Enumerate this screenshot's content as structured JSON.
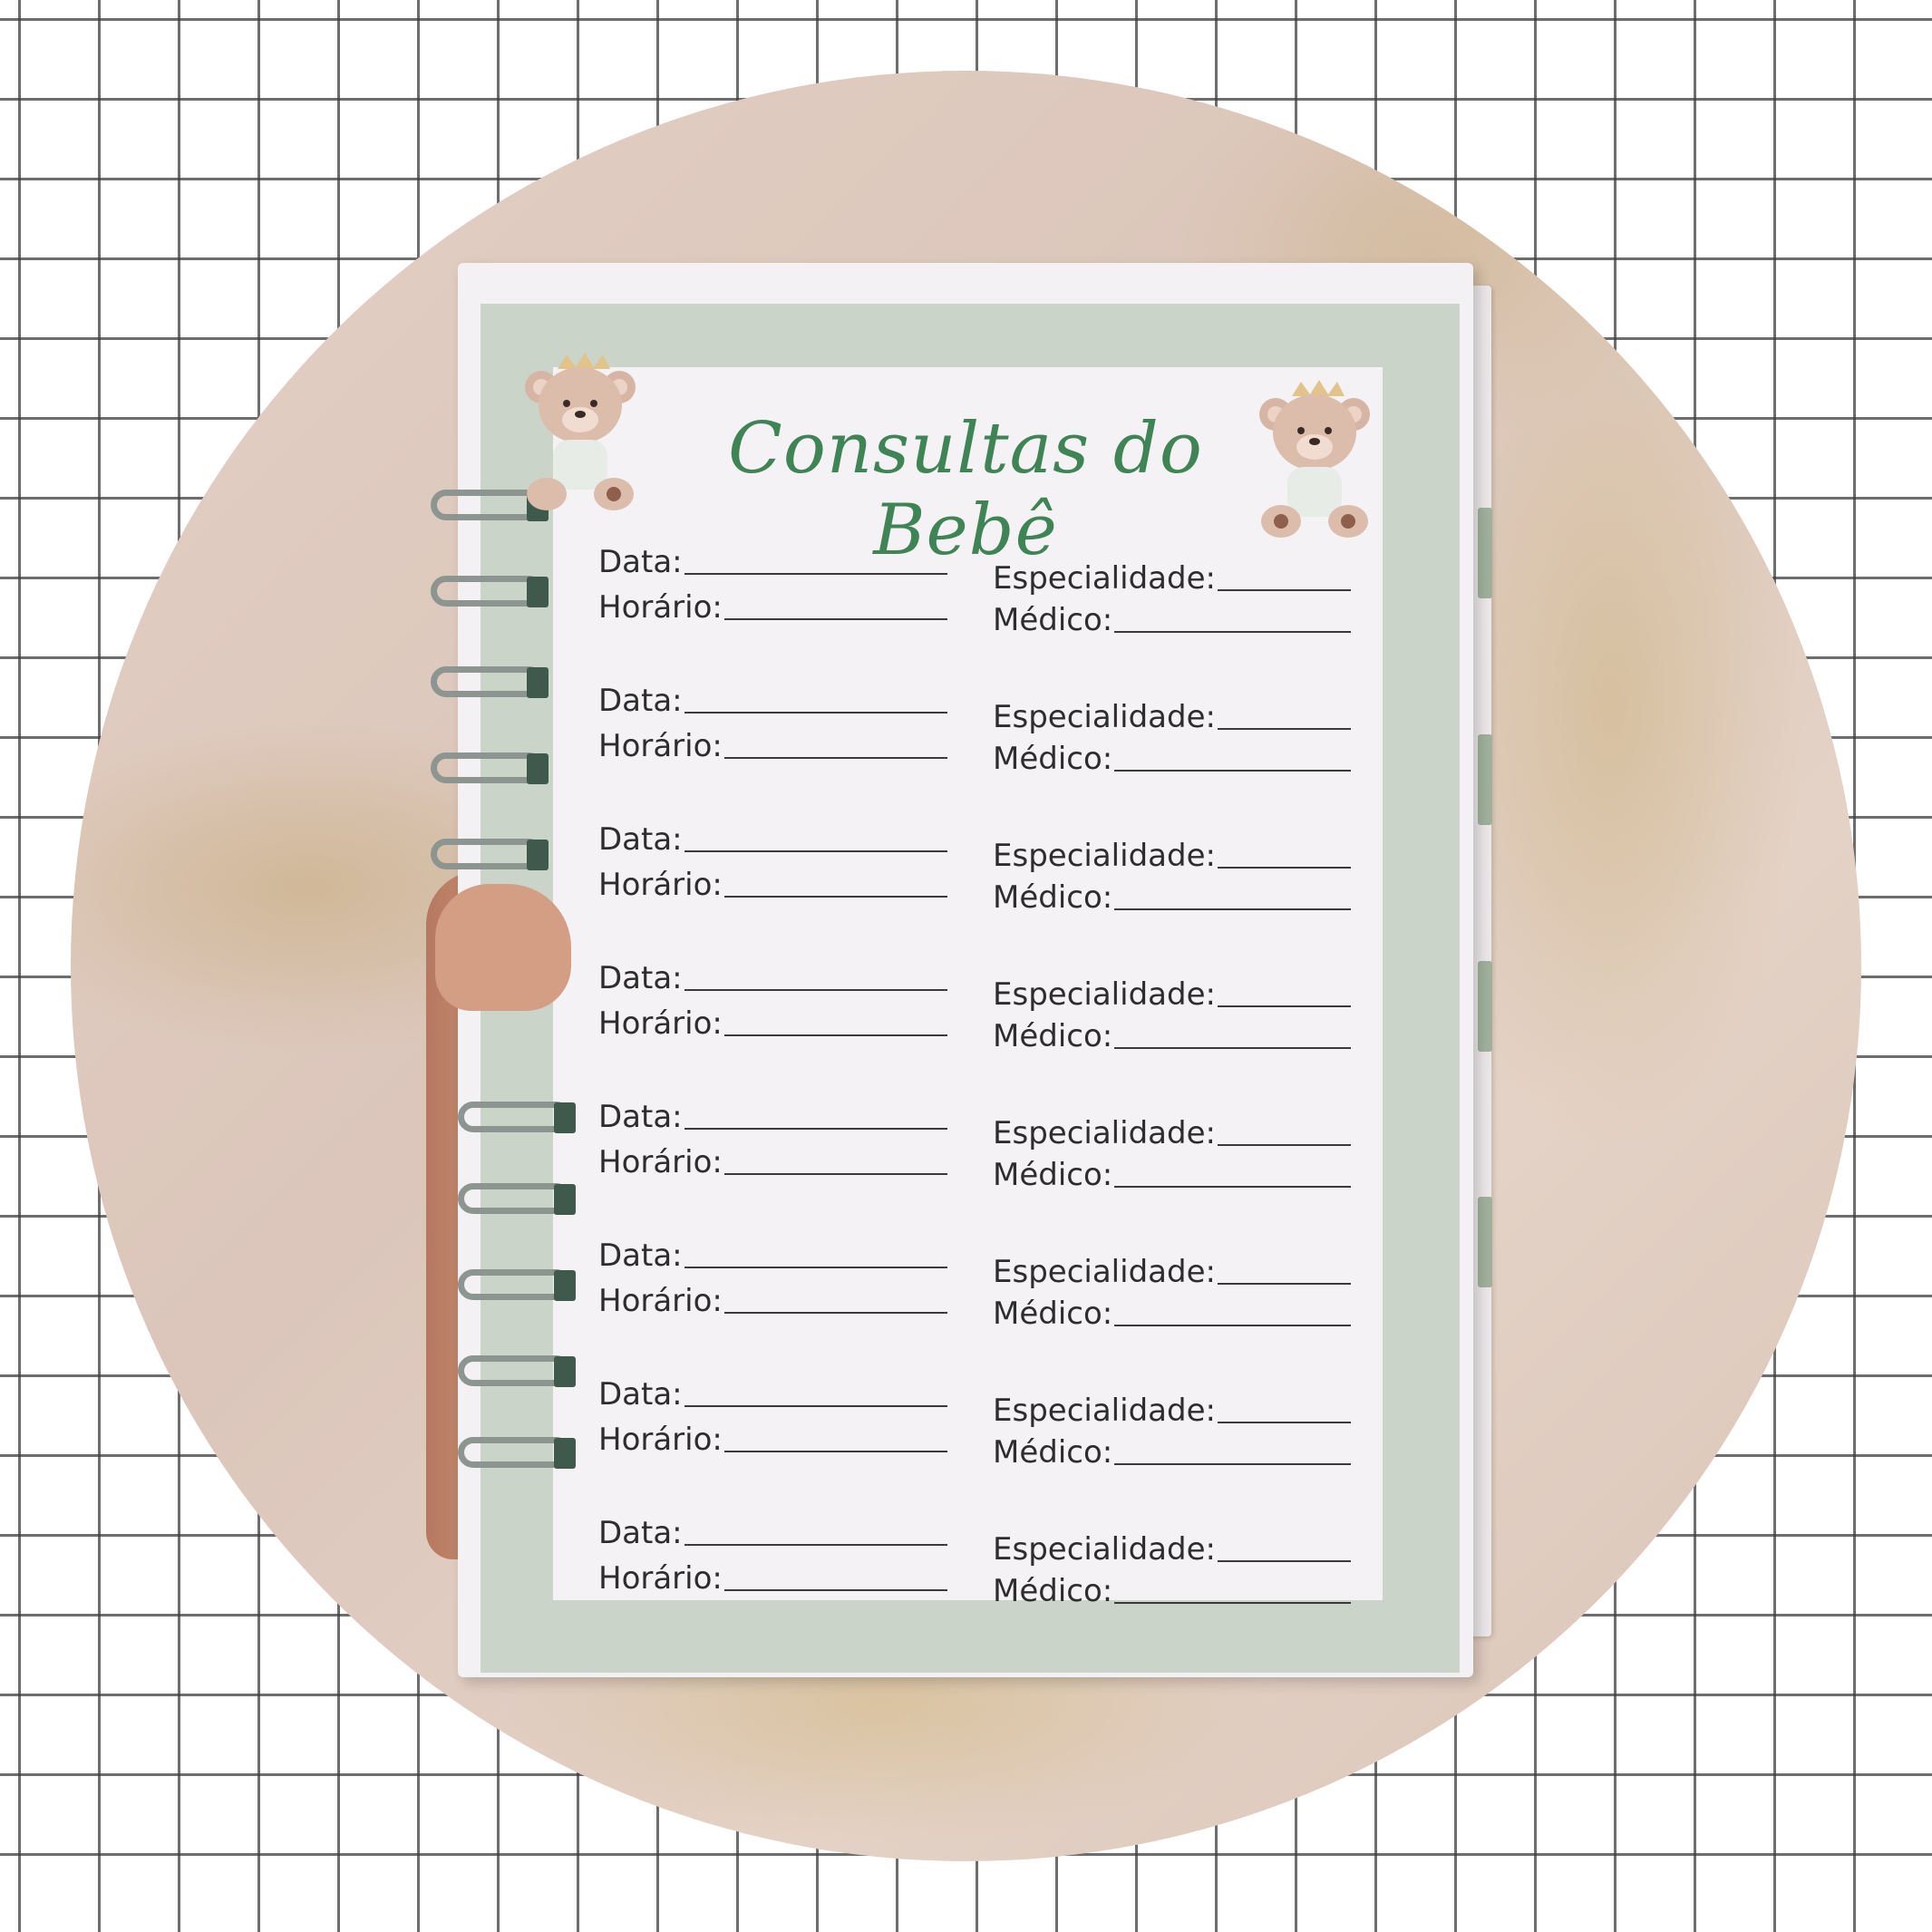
{
  "title": "Consultas do Bebê",
  "entries": [
    {
      "data": "Data:",
      "horario": "Horário:",
      "especialidade": "Especialidade:",
      "medico": "Médico:"
    },
    {
      "data": "Data:",
      "horario": "Horário:",
      "especialidade": "Especialidade:",
      "medico": "Médico:"
    },
    {
      "data": "Data:",
      "horario": "Horário:",
      "especialidade": "Especialidade:",
      "medico": "Médico:"
    },
    {
      "data": "Data:",
      "horario": "Horário:",
      "especialidade": "Especialidade:",
      "medico": "Médico:"
    },
    {
      "data": "Data:",
      "horario": "Horário:",
      "especialidade": "Especialidade:",
      "medico": "Médico:"
    },
    {
      "data": "Data:",
      "horario": "Horário:",
      "especialidade": "Especialidade:",
      "medico": "Médico:"
    },
    {
      "data": "Data:",
      "horario": "Horário:",
      "especialidade": "Especialidade:",
      "medico": "Médico:"
    },
    {
      "data": "Data:",
      "horario": "Horário:",
      "especialidade": "Especialidade:",
      "medico": "Médico:"
    }
  ],
  "colors": {
    "title": "#3e8454",
    "frame": "#cbd4c8",
    "sheet": "#f4f2f5",
    "coil_tab": "#3f5a4c"
  },
  "icons": [
    "teddy-bear-icon",
    "crown-icon",
    "spiral-coil-icon"
  ]
}
